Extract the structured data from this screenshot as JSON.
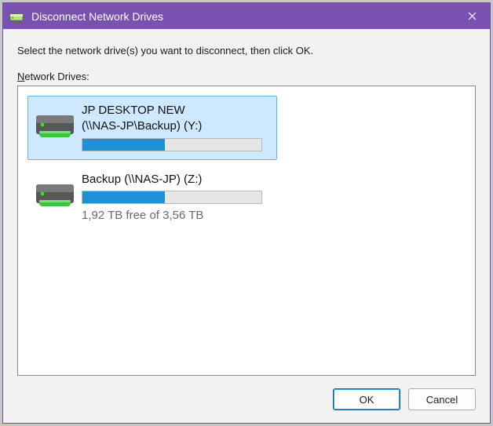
{
  "window": {
    "title": "Disconnect Network Drives",
    "closeLabel": "Close"
  },
  "instruction": "Select the network drive(s) you want to disconnect, then click OK.",
  "listLabel": {
    "prefixUnderlined": "N",
    "rest": "etwork Drives:"
  },
  "drives": [
    {
      "line1": "JP DESKTOP NEW",
      "line2": "(\\\\NAS-JP\\Backup) (Y:)",
      "barFillPercent": 46,
      "freeText": "",
      "selected": true
    },
    {
      "line1": "Backup (\\\\NAS-JP) (Z:)",
      "line2": "",
      "barFillPercent": 46,
      "freeText": "1,92 TB free of 3,56 TB",
      "selected": false
    }
  ],
  "buttons": {
    "ok": "OK",
    "cancel": "Cancel"
  },
  "icons": {
    "app": "network-drive-app-icon",
    "close": "close-icon",
    "drive": "network-drive-icon"
  }
}
